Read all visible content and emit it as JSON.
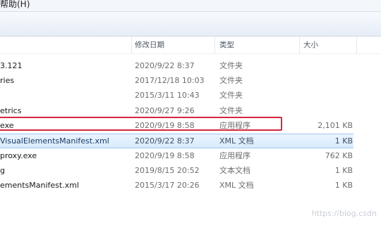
{
  "menu": {
    "help_label": "帮助(H)"
  },
  "columns": {
    "date": "修改日期",
    "type": "类型",
    "size": "大小"
  },
  "rows": [
    {
      "name": "3.121",
      "date": "2020/9/22 8:37",
      "type": "文件夹",
      "size": ""
    },
    {
      "name": "ries",
      "date": "2017/12/18 10:03",
      "type": "文件夹",
      "size": ""
    },
    {
      "name": "",
      "date": "2015/3/11 10:43",
      "type": "文件夹",
      "size": ""
    },
    {
      "name": "etrics",
      "date": "2020/9/27 9:26",
      "type": "文件夹",
      "size": ""
    },
    {
      "name": "exe",
      "date": "2020/9/19 8:58",
      "type": "应用程序",
      "size": "2,101 KB"
    },
    {
      "name": "VisualElementsManifest.xml",
      "date": "2020/9/22 8:37",
      "type": "XML 文档",
      "size": "1 KB"
    },
    {
      "name": "proxy.exe",
      "date": "2020/9/19 8:58",
      "type": "应用程序",
      "size": "762 KB"
    },
    {
      "name": "g",
      "date": "2019/8/15 20:52",
      "type": "文本文档",
      "size": "1 KB"
    },
    {
      "name": "ementsManifest.xml",
      "date": "2015/3/17 20:26",
      "type": "XML 文档",
      "size": "1 KB"
    }
  ],
  "watermark": "https://blog.csdn",
  "colors": {
    "selection": "#d8ebfc",
    "highlight_border": "#d4263c"
  }
}
